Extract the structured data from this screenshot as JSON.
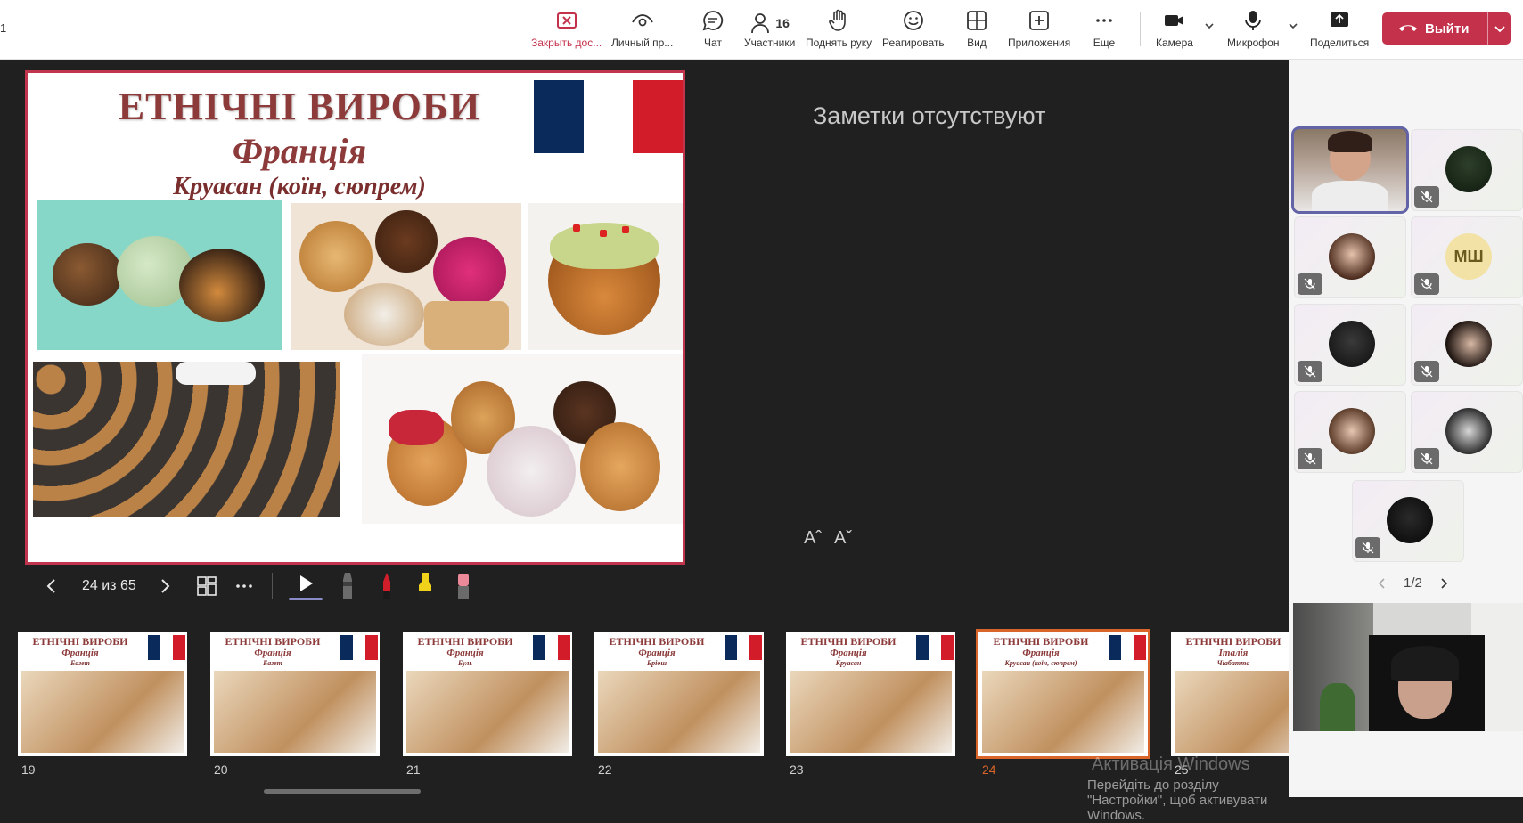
{
  "topbar": {
    "left_text": "1",
    "items": {
      "close": "Закрыть дос...",
      "private": "Личный пр...",
      "chat": "Чат",
      "participants": "Участники",
      "participants_count": "16",
      "raise_hand": "Поднять руку",
      "react": "Реагировать",
      "view": "Вид",
      "apps": "Приложения",
      "more": "Еще",
      "camera": "Камера",
      "mic": "Микрофон",
      "share": "Поделиться"
    },
    "leave_label": "Выйти",
    "colors": {
      "leave": "#c4314b",
      "accent": "#6264a7"
    }
  },
  "slide": {
    "title": "ЕТНІЧНІ ВИРОБИ",
    "subtitle": "Франція",
    "subtitle2": "Круасан (коїн, сюпрем)"
  },
  "notes_text": "Заметки отсутствуют",
  "font_increase": "Aˆ",
  "font_decrease": "Aˇ",
  "slide_nav": {
    "counter": "24 из 65"
  },
  "thumbnails": [
    {
      "num": "19",
      "title": "ЕТНІЧНІ ВИРОБИ",
      "sub": "Франція",
      "sub2": "Багет"
    },
    {
      "num": "20",
      "title": "ЕТНІЧНІ ВИРОБИ",
      "sub": "Франція",
      "sub2": "Багет"
    },
    {
      "num": "21",
      "title": "ЕТНІЧНІ ВИРОБИ",
      "sub": "Франція",
      "sub2": "Буль"
    },
    {
      "num": "22",
      "title": "ЕТНІЧНІ ВИРОБИ",
      "sub": "Франція",
      "sub2": "Бріош"
    },
    {
      "num": "23",
      "title": "ЕТНІЧНІ ВИРОБИ",
      "sub": "Франція",
      "sub2": "Круасан"
    },
    {
      "num": "24",
      "title": "ЕТНІЧНІ ВИРОБИ",
      "sub": "Франція",
      "sub2": "Круасан (коїн, сюпрем)"
    },
    {
      "num": "25",
      "title": "ЕТНІЧНІ ВИРОБИ",
      "sub": "Італія",
      "sub2": "Чіабатта"
    }
  ],
  "participants": {
    "initials": "МШ",
    "pager": "1/2"
  },
  "watermark": {
    "line1": "Активація Windows",
    "line2": "Перейдіть до розділу \"Настройки\", щоб активувати Windows."
  }
}
